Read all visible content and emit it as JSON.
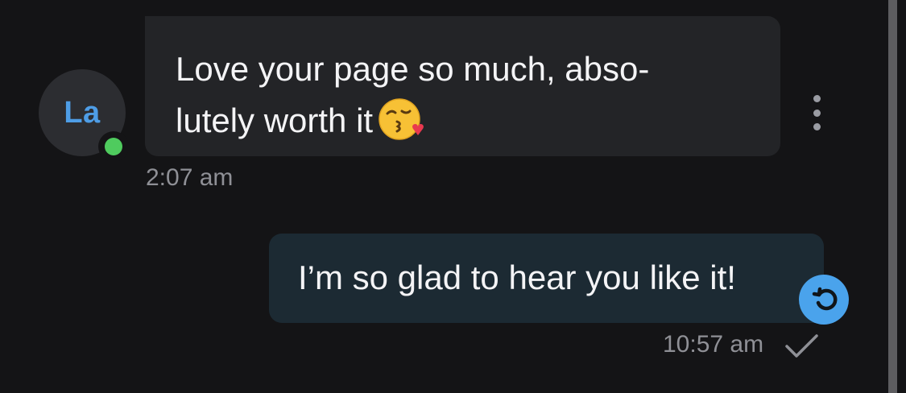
{
  "conversation": {
    "incoming": {
      "avatar_initials": "La",
      "online_status_color": "#4fcb5e",
      "text": "Love your page so much, abso-\nlutely worth it",
      "emoji_icon": "face-throwing-kiss-icon",
      "time": "2:07 am",
      "menu_icon": "more-vertical-icon"
    },
    "outgoing": {
      "text": "I’m so glad to hear you like it!",
      "time": "10:57 am",
      "status_icon": "sent-check-icon",
      "action_icon": "undo-arrow-icon"
    }
  },
  "colors": {
    "background": "#141416",
    "incoming_bubble": "#232427",
    "outgoing_bubble": "#1c2a33",
    "accent": "#4aa3ec",
    "avatar_text": "#4e9de6"
  }
}
